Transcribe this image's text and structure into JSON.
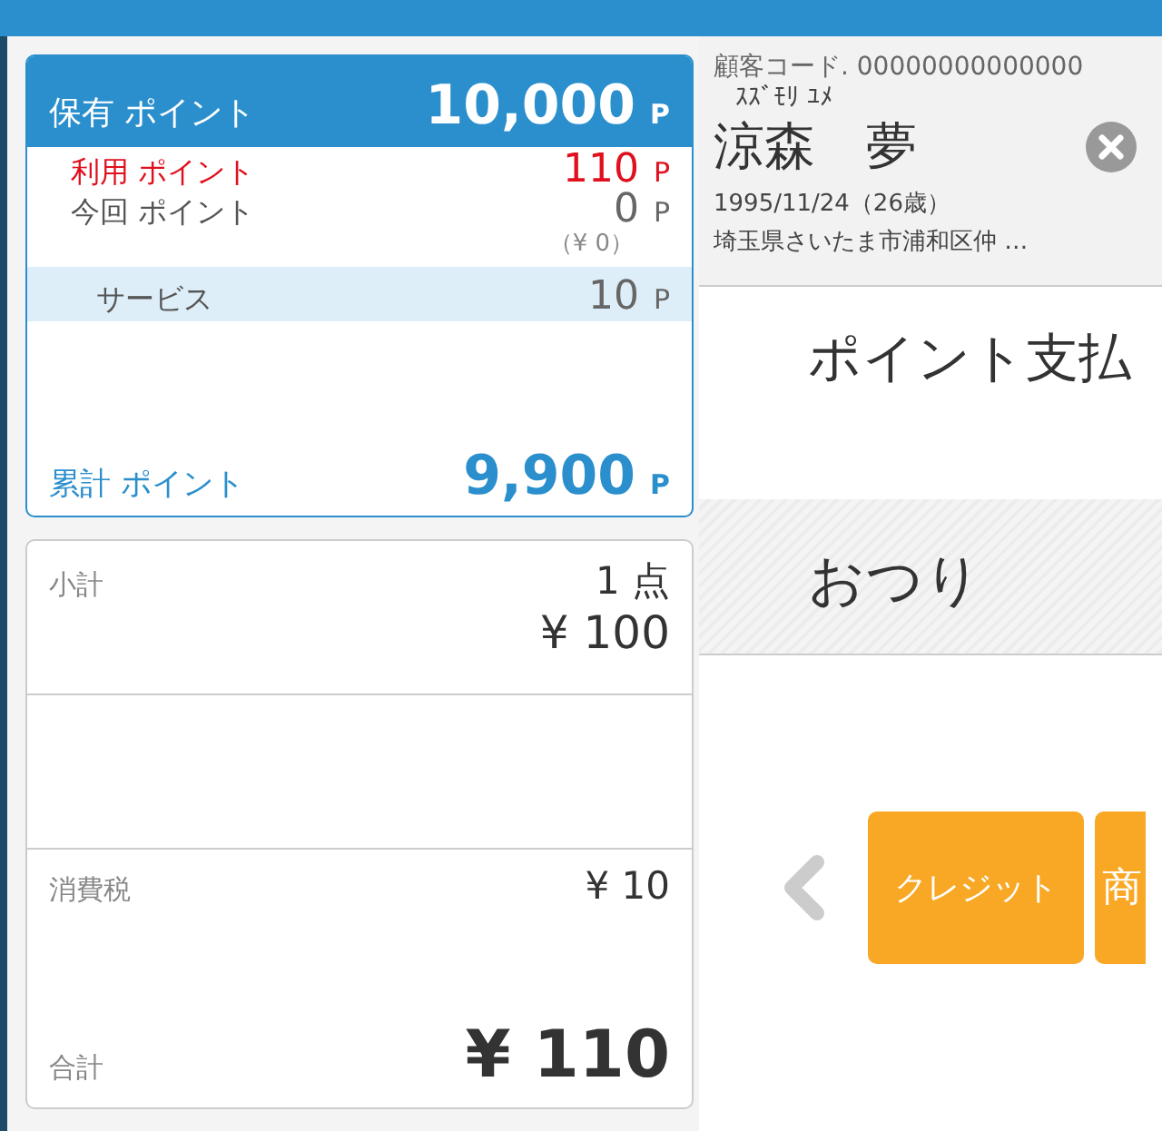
{
  "points": {
    "held_label": "保有 ポイント",
    "held_value": "10,000",
    "unit": "P",
    "rows": [
      {
        "kind": "used",
        "label": "利用 ポイント",
        "value": "110",
        "unit": "P"
      },
      {
        "kind": "normal",
        "label": "今回 ポイント",
        "value": "0",
        "unit": "P",
        "note": "（¥ 0）"
      },
      {
        "kind": "service",
        "label": "サービス",
        "value": "10",
        "unit": "P"
      }
    ],
    "total_label": "累計 ポイント",
    "total_value": "9,900",
    "total_unit": "P"
  },
  "summary": {
    "subtotal_label": "小計",
    "count": "1 点",
    "subtotal": "¥ 100",
    "tax_label": "消費税",
    "tax": "¥ 10",
    "total_label": "合計",
    "total": "¥ 110"
  },
  "customer": {
    "code": "顧客コード. 00000000000000",
    "kana": "ｽｽﾞﾓﾘ ﾕﾒ",
    "name": "涼森　夢",
    "birth": "1995/11/24（26歳）",
    "address": "埼玉県さいたま市浦和区仲 …"
  },
  "payment_title": "ポイント支払",
  "change_label": "おつり",
  "buttons": [
    {
      "label": "クレジット"
    },
    {
      "label": "商"
    }
  ]
}
